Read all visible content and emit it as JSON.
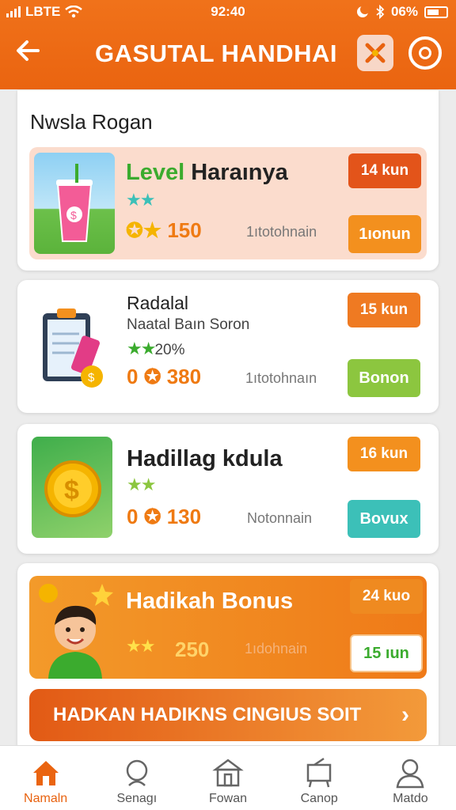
{
  "status": {
    "carrier": "LBTE",
    "time": "92:40",
    "battery": "06%"
  },
  "header": {
    "title": "GASUTAL HANDHAI"
  },
  "section": {
    "title": "Nwsla Rogan"
  },
  "cards": [
    {
      "name_prefix": "Level",
      "name_rest": " Haraınya",
      "stars": 2,
      "points": "150",
      "meta": "1ıtotohnain",
      "badge": "14 kun",
      "action": "1ıonun"
    },
    {
      "name": "Radalal",
      "subtitle": "Naatal Baın Soron",
      "stars": 2,
      "stars_text": "20%",
      "points": "380",
      "meta": "1ıtotohnaın",
      "badge": "15 kun",
      "action": "Bonon"
    },
    {
      "name": "Hadillag kdula",
      "stars": 2,
      "points": "130",
      "meta": "Notonnain",
      "badge": "16 kun",
      "action": "Bovux"
    },
    {
      "name": "Hadikah Bonus",
      "stars": 2,
      "points": "250",
      "meta": "1ıdohnain",
      "badge": "24 kuo",
      "action": "15 ıun"
    }
  ],
  "cta": {
    "label": "HADKAN HADIKNS CINGIUS SOIT"
  },
  "nav": [
    {
      "label": "Namaln",
      "icon": "home-icon"
    },
    {
      "label": "Senagı",
      "icon": "search-icon"
    },
    {
      "label": "Fowan",
      "icon": "store-icon"
    },
    {
      "label": "Canop",
      "icon": "cart-icon"
    },
    {
      "label": "Matdo",
      "icon": "profile-icon"
    }
  ],
  "colors": {
    "accent": "#ea6410",
    "green": "#3bab2e",
    "teal": "#3cc0b8",
    "lime": "#8cc63f"
  }
}
